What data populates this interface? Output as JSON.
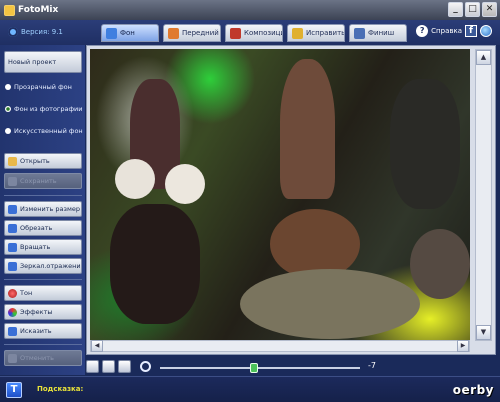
{
  "window": {
    "title": "FotoMix",
    "min_label": "_",
    "max_label": "□",
    "close_label": "✕"
  },
  "header": {
    "version": "Версия: 9.1",
    "tabs": [
      {
        "label": "Фон",
        "icon": "background-icon",
        "color": "#3f7fe0"
      },
      {
        "label": "Передний пл",
        "icon": "foreground-icon",
        "color": "#e07a2f"
      },
      {
        "label": "Композиция",
        "icon": "composition-icon",
        "color": "#c0392b"
      },
      {
        "label": "Исправить",
        "icon": "fix-icon",
        "color": "#e0b02f"
      },
      {
        "label": "Финиш",
        "icon": "finish-icon",
        "color": "#4a6fb5"
      }
    ],
    "help_label": "Справка",
    "fb_label": "f"
  },
  "sidebar": {
    "new_project": "Новый проект",
    "radios": [
      {
        "label": "Прозрачный фон",
        "checked": false
      },
      {
        "label": "Фон из фотографии",
        "checked": true
      },
      {
        "label": "Искусственный фон",
        "checked": false
      }
    ],
    "open": "Открыть",
    "save": "Сохранить",
    "resize": "Изменить размер",
    "crop": "Обрезать",
    "rotate": "Вращать",
    "mirror": "Зеркал.отражение",
    "tone": "Тон",
    "effects": "Эффекты",
    "distort": "Исказить",
    "undo": "Отменить"
  },
  "zoom": {
    "value_percent": 47,
    "end_label": "-7"
  },
  "status": {
    "hint_label": "Подсказка:",
    "hint_icon_label": "T",
    "watermark": "oerby"
  },
  "colors": {
    "accent_green": "#4cc25a",
    "hint_yellow": "#e8e23a",
    "panel_blue": "#22346e"
  }
}
